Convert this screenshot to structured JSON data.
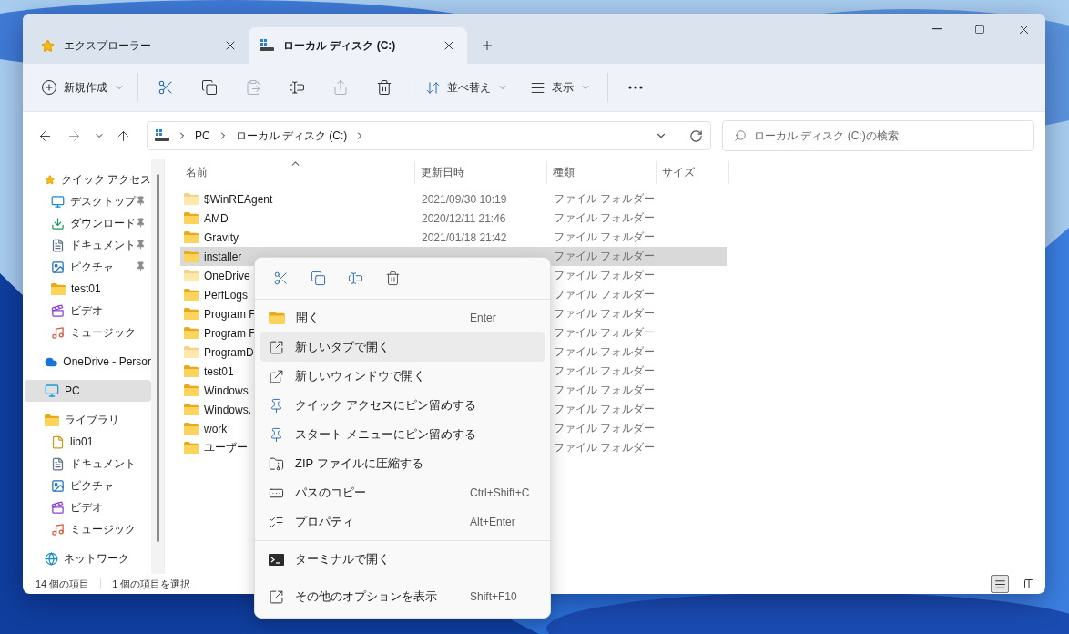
{
  "tabs": [
    {
      "label": "エクスプローラー",
      "selected": false
    },
    {
      "label": "ローカル ディスク (C:)",
      "selected": true
    }
  ],
  "toolbar": {
    "new_label": "新規作成",
    "actions": [
      {
        "kind": "cut",
        "disabled": false
      },
      {
        "kind": "copy",
        "disabled": false
      },
      {
        "kind": "paste",
        "disabled": true
      },
      {
        "kind": "rename",
        "disabled": false
      },
      {
        "kind": "share",
        "disabled": true
      },
      {
        "kind": "delete",
        "disabled": false
      }
    ],
    "sort_label": "並べ替え",
    "view_label": "表示"
  },
  "address": {
    "segments": [
      "PC",
      "ローカル ディスク (C:)"
    ]
  },
  "search": {
    "placeholder": "ローカル ディスク (C:)の検索"
  },
  "sidebar": {
    "items": [
      {
        "label": "クイック アクセス",
        "selected": false,
        "pinned": false,
        "children": [
          {
            "label": "デスクトップ",
            "selected": false,
            "pinned": true
          },
          {
            "label": "ダウンロード",
            "selected": false,
            "pinned": true
          },
          {
            "label": "ドキュメント",
            "selected": false,
            "pinned": true
          },
          {
            "label": "ピクチャ",
            "selected": false,
            "pinned": true
          },
          {
            "label": "test01",
            "selected": false,
            "pinned": false
          },
          {
            "label": "ビデオ",
            "selected": false,
            "pinned": false
          },
          {
            "label": "ミュージック",
            "selected": false,
            "pinned": false
          }
        ]
      },
      {
        "label": "OneDrive - Persor",
        "selected": false,
        "pinned": false
      },
      {
        "label": "PC",
        "selected": true,
        "pinned": false
      },
      {
        "label": "ライブラリ",
        "selected": false,
        "pinned": false,
        "children": [
          {
            "label": "lib01",
            "selected": false,
            "pinned": false
          },
          {
            "label": "ドキュメント",
            "selected": false,
            "pinned": false
          },
          {
            "label": "ピクチャ",
            "selected": false,
            "pinned": false
          },
          {
            "label": "ビデオ",
            "selected": false,
            "pinned": false
          },
          {
            "label": "ミュージック",
            "selected": false,
            "pinned": false
          }
        ]
      },
      {
        "label": "ネットワーク",
        "selected": false,
        "pinned": false
      }
    ]
  },
  "columns": [
    "名前",
    "更新日時",
    "種類",
    "サイズ"
  ],
  "rows": [
    {
      "name": "$WinREAgent",
      "date": "2021/09/30 10:19",
      "type": "ファイル フォルダー",
      "hidden": true,
      "selected": false
    },
    {
      "name": "AMD",
      "date": "2020/12/11 21:46",
      "type": "ファイル フォルダー",
      "hidden": false,
      "selected": false
    },
    {
      "name": "Gravity",
      "date": "2021/01/18 21:42",
      "type": "ファイル フォルダー",
      "hidden": false,
      "selected": false
    },
    {
      "name": "installer",
      "type": "ファイル フォルダー",
      "hidden": false,
      "selected": true
    },
    {
      "name": "OneDrive",
      "type": "ファイル フォルダー",
      "hidden": true,
      "selected": false
    },
    {
      "name": "PerfLogs",
      "type": "ファイル フォルダー",
      "hidden": false,
      "selected": false
    },
    {
      "name": "Program F",
      "type": "ファイル フォルダー",
      "hidden": false,
      "selected": false
    },
    {
      "name": "Program F",
      "type": "ファイル フォルダー",
      "hidden": false,
      "selected": false
    },
    {
      "name": "ProgramD",
      "type": "ファイル フォルダー",
      "hidden": true,
      "selected": false
    },
    {
      "name": "test01",
      "type": "ファイル フォルダー",
      "hidden": false,
      "selected": false
    },
    {
      "name": "Windows",
      "type": "ファイル フォルダー",
      "hidden": false,
      "selected": false
    },
    {
      "name": "Windows.",
      "type": "ファイル フォルダー",
      "hidden": false,
      "selected": false
    },
    {
      "name": "work",
      "type": "ファイル フォルダー",
      "hidden": false,
      "selected": false
    },
    {
      "name": "ユーザー",
      "type": "ファイル フォルダー",
      "hidden": false,
      "selected": false
    }
  ],
  "status_bar": {
    "item_count": "14 個の項目",
    "selection": "1 個の項目を選択",
    "view_modes": [
      {
        "kind": "details",
        "selected": true
      },
      {
        "kind": "tiles",
        "selected": false
      }
    ]
  },
  "context_menu": {
    "groups": [
      [
        {
          "label": "開く",
          "shortcut": "Enter",
          "highlighted": false
        },
        {
          "label": "新しいタブで開く",
          "highlighted": true
        },
        {
          "label": "新しいウィンドウで開く",
          "highlighted": false
        },
        {
          "label": "クイック アクセスにピン留めする",
          "highlighted": false
        },
        {
          "label": "スタート メニューにピン留めする",
          "highlighted": false
        },
        {
          "label": "ZIP ファイルに圧縮する",
          "highlighted": false
        },
        {
          "label": "パスのコピー",
          "shortcut": "Ctrl+Shift+C",
          "highlighted": false
        },
        {
          "label": "プロパティ",
          "shortcut": "Alt+Enter",
          "highlighted": false
        }
      ],
      [
        {
          "label": "ターミナルで開く",
          "highlighted": false
        }
      ],
      [
        {
          "label": "その他のオプションを表示",
          "shortcut": "Shift+F10",
          "highlighted": false
        }
      ]
    ]
  }
}
